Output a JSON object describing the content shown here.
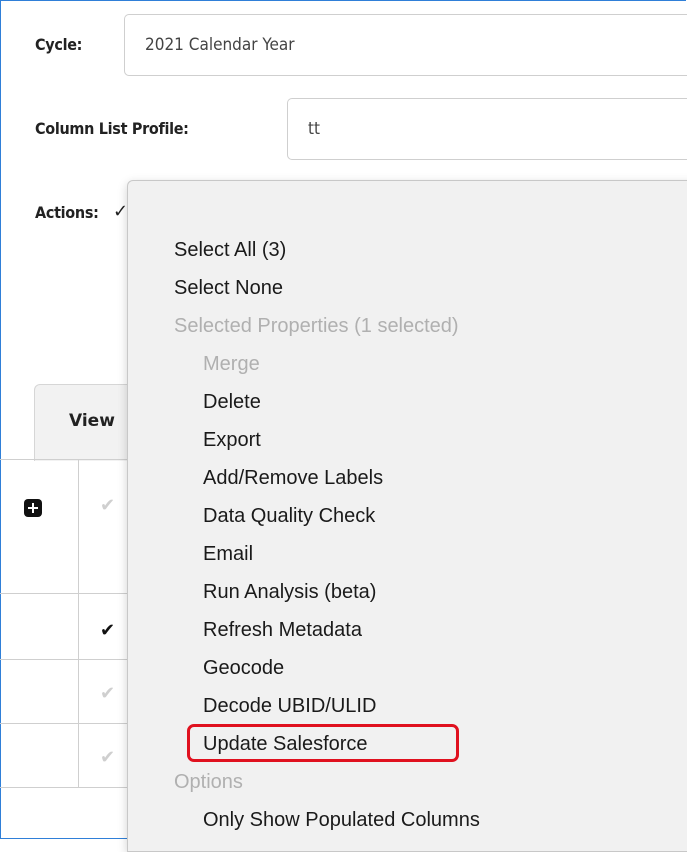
{
  "form": {
    "cycle_label": "Cycle:",
    "cycle_value": "2021 Calendar Year",
    "column_profile_label": "Column List Profile:",
    "column_profile_value": "tt",
    "actions_label": "Actions:",
    "actions_check": "✓"
  },
  "background_table": {
    "tab_label": "View"
  },
  "menu": {
    "items": [
      {
        "label": "Select All (3)",
        "enabled": true
      },
      {
        "label": "Select None",
        "enabled": true
      },
      {
        "label": "Selected Properties (1 selected)",
        "enabled": false
      },
      {
        "label": "Merge",
        "enabled": false
      },
      {
        "label": "Delete",
        "enabled": true
      },
      {
        "label": "Export",
        "enabled": true
      },
      {
        "label": "Add/Remove Labels",
        "enabled": true
      },
      {
        "label": "Data Quality Check",
        "enabled": true
      },
      {
        "label": "Email",
        "enabled": true
      },
      {
        "label": "Run Analysis (beta)",
        "enabled": true
      },
      {
        "label": "Refresh Metadata",
        "enabled": true
      },
      {
        "label": "Geocode",
        "enabled": true
      },
      {
        "label": "Decode UBID/ULID",
        "enabled": true
      },
      {
        "label": "Update Salesforce",
        "enabled": true,
        "highlighted": true
      },
      {
        "label": "Options",
        "enabled": false
      },
      {
        "label": "Only Show Populated Columns",
        "enabled": true
      }
    ],
    "highlight_color": "#e0111f"
  }
}
